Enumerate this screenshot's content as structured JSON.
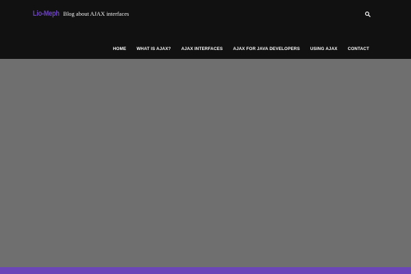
{
  "header": {
    "site_title": "Lio-Meph",
    "tagline": "Blog about AJAX interfaces",
    "search_icon": "search-icon"
  },
  "nav": {
    "items": [
      {
        "label": "HOME"
      },
      {
        "label": "WHAT IS AJAX?"
      },
      {
        "label": "AJAX INTERFACES"
      },
      {
        "label": "AJAX FOR JAVA DEVELOPERS"
      },
      {
        "label": "USING AJAX"
      },
      {
        "label": "CONTACT"
      }
    ]
  },
  "colors": {
    "header_background": "#111111",
    "hero_background": "#6f6f6f",
    "accent": "#6b46b8",
    "nav_text": "#ffffff"
  }
}
